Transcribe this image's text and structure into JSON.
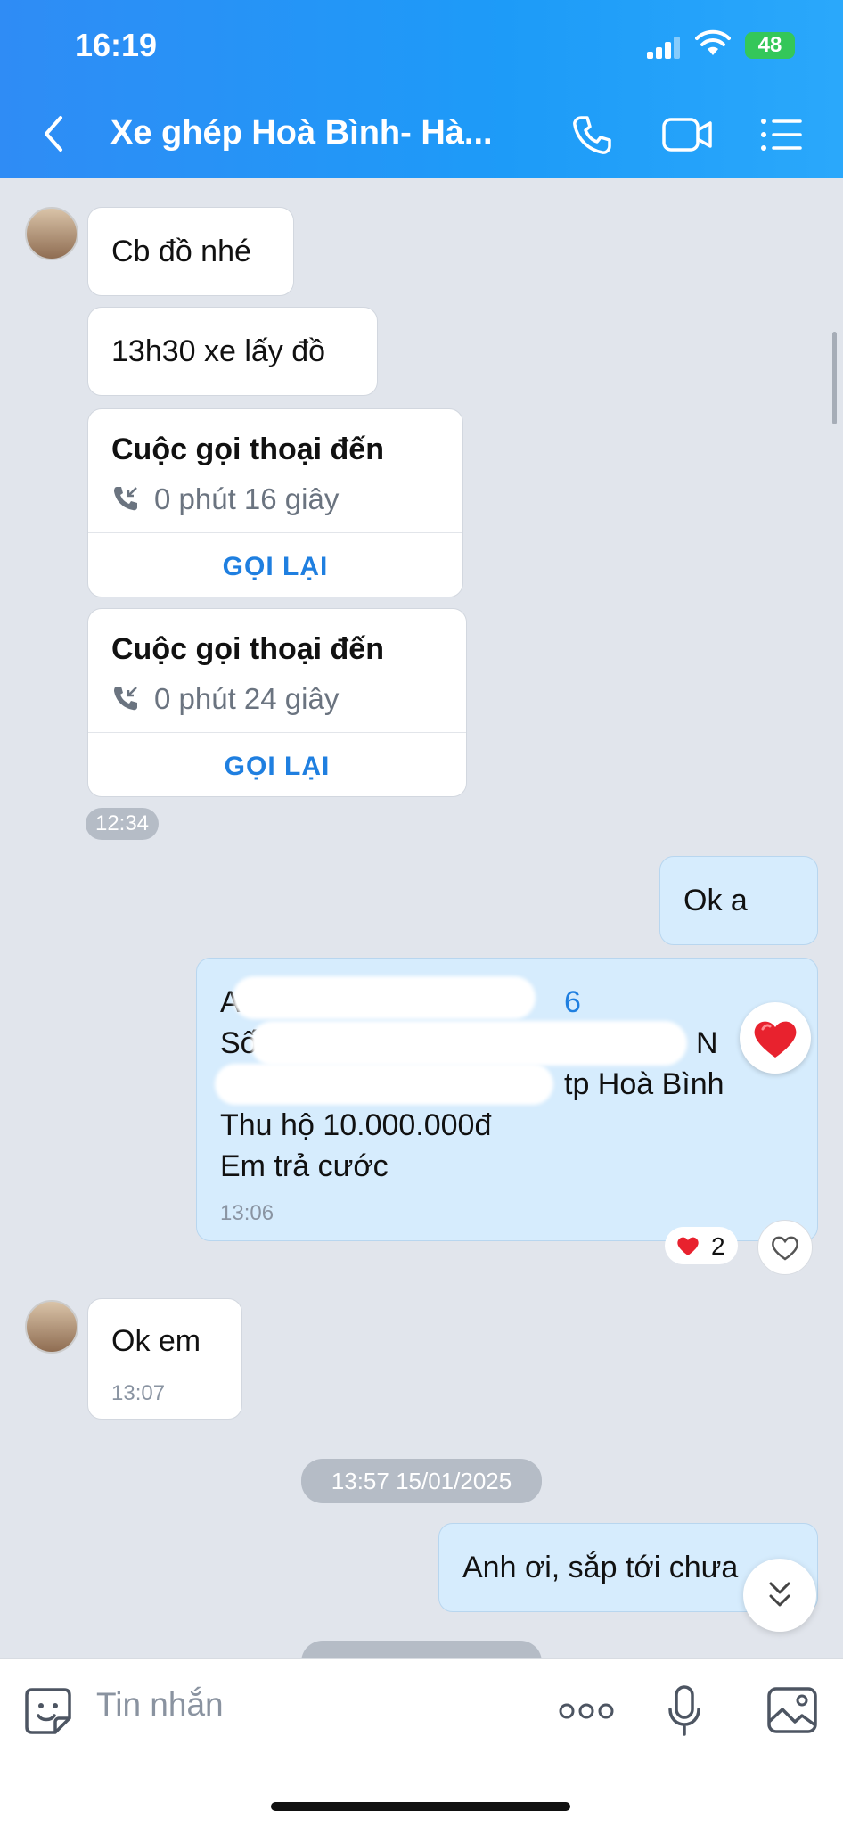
{
  "status_bar": {
    "time": "16:19",
    "battery": "48"
  },
  "header": {
    "title": "Xe ghép Hoà Bình- Hà..."
  },
  "messages": {
    "m1": "Cb đồ nhé",
    "m2": "13h30 xe lấy đồ",
    "call1": {
      "title": "Cuộc gọi thoại đến",
      "duration": "0 phút 16 giây",
      "action": "GỌI LẠI"
    },
    "call2": {
      "title": "Cuộc gọi thoại đến",
      "duration": "0 phút 24 giây",
      "action": "GỌI LẠI"
    },
    "time1": "12:34",
    "out1": "Ok a",
    "out2": {
      "line1": "A",
      "line1_tail": "6",
      "line2": "Số n",
      "line2_tail": "N",
      "line3": "t",
      "line3_tail": "tp Hoà Bình",
      "line4": "Thu hộ 10.000.000đ",
      "line5": "Em trả cước",
      "time": "13:06"
    },
    "reaction_count": "2",
    "in_ok": "Ok em",
    "in_ok_time": "13:07",
    "date_sep": "13:57 15/01/2025",
    "out3": "Anh ơi, sắp tới chưa"
  },
  "composer": {
    "placeholder": "Tin nhắn"
  },
  "colors": {
    "header": "#1d9bf8",
    "outgoing": "#d6ecfd",
    "link": "#1f7fe0"
  }
}
